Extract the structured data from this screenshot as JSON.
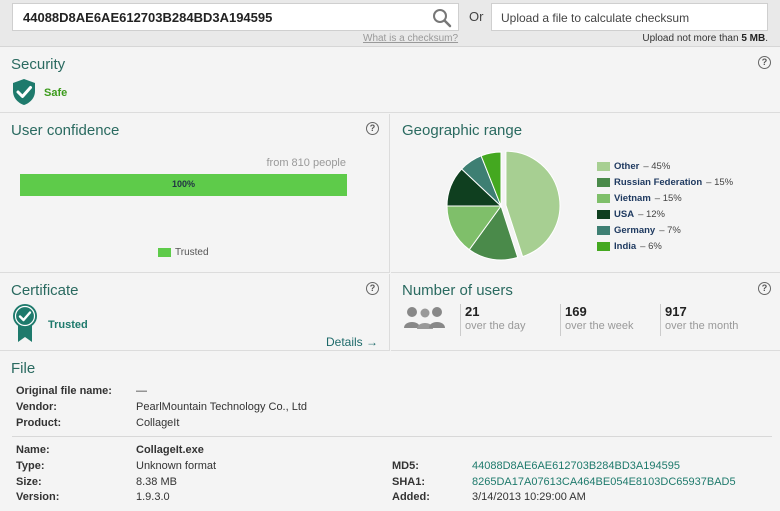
{
  "search": {
    "value": "44088D8AE6AE612703B284BD3A194595"
  },
  "or_label": "Or",
  "upload": {
    "label": "Upload a file to calculate checksum",
    "note_prefix": "Upload not more than",
    "note_limit": "5 MB",
    "note_suffix": "."
  },
  "what_link": "What is a checksum?",
  "security": {
    "title": "Security",
    "status": "Safe"
  },
  "confidence": {
    "title": "User confidence",
    "from": "from 810 people",
    "percent_label": "100%",
    "percent": 100,
    "legend": "Trusted",
    "color": "#5ecb4a"
  },
  "geo": {
    "title": "Geographic range",
    "chart_data": {
      "type": "pie",
      "slices": [
        {
          "name": "Other",
          "value": 45,
          "color": "#a7cf92"
        },
        {
          "name": "Russian Federation",
          "value": 15,
          "color": "#4a8a4a"
        },
        {
          "name": "Vietnam",
          "value": 15,
          "color": "#7fbf6a"
        },
        {
          "name": "USA",
          "value": 12,
          "color": "#0f3f1f"
        },
        {
          "name": "Germany",
          "value": 7,
          "color": "#3e7f73"
        },
        {
          "name": "India",
          "value": 6,
          "color": "#44a820"
        }
      ]
    }
  },
  "certificate": {
    "title": "Certificate",
    "status": "Trusted",
    "details": "Details →"
  },
  "users": {
    "title": "Number of users",
    "stats": [
      {
        "num": "21",
        "label": "over the day"
      },
      {
        "num": "169",
        "label": "over the week"
      },
      {
        "num": "917",
        "label": "over the month"
      }
    ]
  },
  "file": {
    "title": "File",
    "original_name_label": "Original file name:",
    "original_name": "—",
    "vendor_label": "Vendor:",
    "vendor": "PearlMountain Technology Co., Ltd",
    "product_label": "Product:",
    "product": "CollageIt",
    "name_label": "Name:",
    "name": "CollageIt.exe",
    "type_label": "Type:",
    "type": "Unknown format",
    "size_label": "Size:",
    "size": "8.38 MB",
    "version_label": "Version:",
    "version": "1.9.3.0",
    "md5_label": "MD5:",
    "md5": "44088D8AE6AE612703B284BD3A194595",
    "sha1_label": "SHA1:",
    "sha1": "8265DA17A07613CA464BE054E8103DC65937BAD5",
    "added_label": "Added:",
    "added": "3/14/2013 10:29:00 AM"
  }
}
